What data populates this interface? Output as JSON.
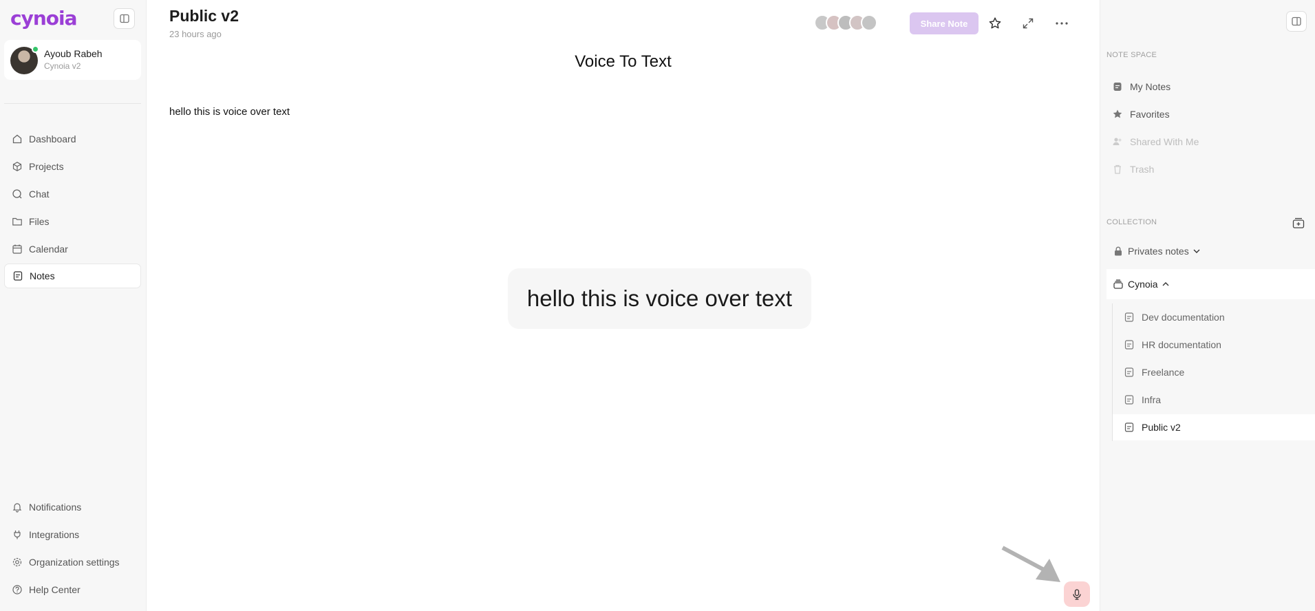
{
  "brand": {
    "logo_text": "cynoia",
    "accent": "#9b3fd6"
  },
  "user": {
    "name": "Ayoub Rabeh",
    "org": "Cynoia v2",
    "status": "online"
  },
  "nav": {
    "main": [
      {
        "label": "Dashboard",
        "icon": "home-icon"
      },
      {
        "label": "Projects",
        "icon": "cube-icon"
      },
      {
        "label": "Chat",
        "icon": "chat-icon"
      },
      {
        "label": "Files",
        "icon": "folder-icon"
      },
      {
        "label": "Calendar",
        "icon": "calendar-icon"
      },
      {
        "label": "Notes",
        "icon": "note-icon",
        "active": true
      }
    ],
    "bottom": [
      {
        "label": "Notifications",
        "icon": "bell-icon"
      },
      {
        "label": "Integrations",
        "icon": "plug-icon"
      },
      {
        "label": "Organization settings",
        "icon": "gear-icon"
      },
      {
        "label": "Help Center",
        "icon": "help-icon"
      }
    ]
  },
  "note": {
    "title": "Public v2",
    "updated": "23 hours ago",
    "share_label": "Share Note",
    "heading": "Voice To Text",
    "body": "hello this is voice over text",
    "transcript_bubble": "hello this is voice over text"
  },
  "right_panel": {
    "note_space_title": "NOTE SPACE",
    "note_space": [
      {
        "label": "My Notes",
        "icon": "note-icon"
      },
      {
        "label": "Favorites",
        "icon": "star-icon"
      },
      {
        "label": "Shared With Me",
        "icon": "users-icon",
        "disabled": true
      },
      {
        "label": "Trash",
        "icon": "trash-icon",
        "disabled": true
      }
    ],
    "collection_title": "COLLECTION",
    "collections": [
      {
        "label": "Privates notes",
        "icon": "lock-icon",
        "expanded": false
      },
      {
        "label": "Cynoia",
        "icon": "stack-icon",
        "expanded": true
      }
    ],
    "docs": [
      {
        "label": "Dev documentation"
      },
      {
        "label": "HR documentation"
      },
      {
        "label": "Freelance"
      },
      {
        "label": "Infra"
      },
      {
        "label": "Public v2",
        "active": true
      }
    ]
  },
  "colors": {
    "mic_bg": "#fbd3d3",
    "share_bg": "#dbc6f0"
  }
}
